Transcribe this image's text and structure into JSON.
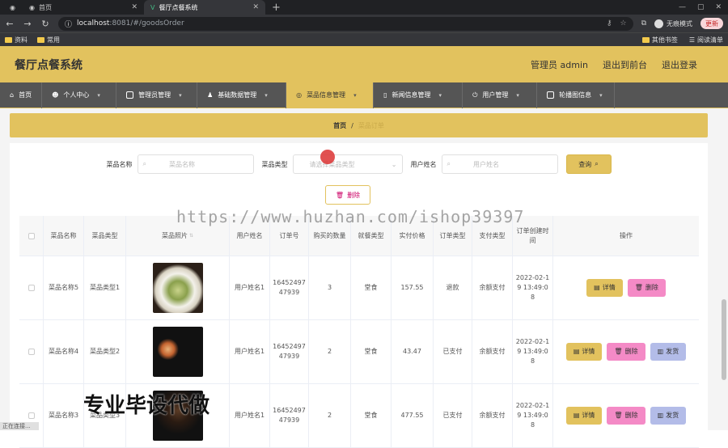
{
  "browser": {
    "tabs": [
      {
        "title": "",
        "active": false
      },
      {
        "title": "首页",
        "active": false
      },
      {
        "title": "餐厅点餐系统",
        "active": true
      }
    ],
    "url_host": "localhost",
    "url_rest": ":8081/#/goodsOrder",
    "incognito": "无痕模式",
    "update": "更新",
    "bookmarks": [
      "资料",
      "常用"
    ],
    "bookmarks_right": [
      "其他书签",
      "阅读清单"
    ]
  },
  "app": {
    "name": "餐厅点餐系统",
    "header_links": [
      "管理员 admin",
      "退出到前台",
      "退出登录"
    ],
    "nav": [
      {
        "label": "首页",
        "active": false
      },
      {
        "label": "个人中心",
        "active": false
      },
      {
        "label": "管理员管理",
        "active": false
      },
      {
        "label": "基础数据管理",
        "active": false
      },
      {
        "label": "菜品信息管理",
        "active": true
      },
      {
        "label": "新闻信息管理",
        "active": false
      },
      {
        "label": "用户管理",
        "active": false
      },
      {
        "label": "轮播图信息",
        "active": false
      }
    ],
    "breadcrumb": {
      "home": "首页",
      "sep": "/",
      "current": "菜品订单"
    }
  },
  "search": {
    "dish_name_label": "菜品名称",
    "dish_name_placeholder": "菜品名称",
    "dish_type_label": "菜品类型",
    "dish_type_placeholder": "请选择菜品类型",
    "user_name_label": "用户姓名",
    "user_name_placeholder": "用户姓名",
    "query_label": "查询"
  },
  "toolbar": {
    "delete_label": "删除"
  },
  "table": {
    "headers": [
      "菜品名称",
      "菜品类型",
      "菜品照片",
      "用户姓名",
      "订单号",
      "购买的数量",
      "就餐类型",
      "实付价格",
      "订单类型",
      "支付类型",
      "订单创建时间",
      "操作"
    ],
    "rows": [
      {
        "dish": "菜品名称5",
        "type": "菜品类型1",
        "user": "用户姓名1",
        "order": "1645249747939",
        "qty": "3",
        "dine": "堂食",
        "price": "157.55",
        "status": "退款",
        "pay": "余额支付",
        "time": "2022-02-19 13:49:08",
        "actions": [
          "详情",
          "删除"
        ]
      },
      {
        "dish": "菜品名称4",
        "type": "菜品类型2",
        "user": "用户姓名1",
        "order": "1645249747939",
        "qty": "2",
        "dine": "堂食",
        "price": "43.47",
        "status": "已支付",
        "pay": "余额支付",
        "time": "2022-02-19 13:49:08",
        "actions": [
          "详情",
          "删除",
          "发货"
        ]
      },
      {
        "dish": "菜品名称3",
        "type": "菜品类型3",
        "user": "用户姓名1",
        "order": "1645249747939",
        "qty": "2",
        "dine": "堂食",
        "price": "477.55",
        "status": "已支付",
        "pay": "余额支付",
        "time": "2022-02-19 13:49:08",
        "actions": [
          "详情",
          "删除",
          "发货"
        ]
      }
    ]
  },
  "watermark": "https://www.huzhan.com/ishop39397",
  "overlay": "专业毕设代做",
  "status": "正在连接..."
}
